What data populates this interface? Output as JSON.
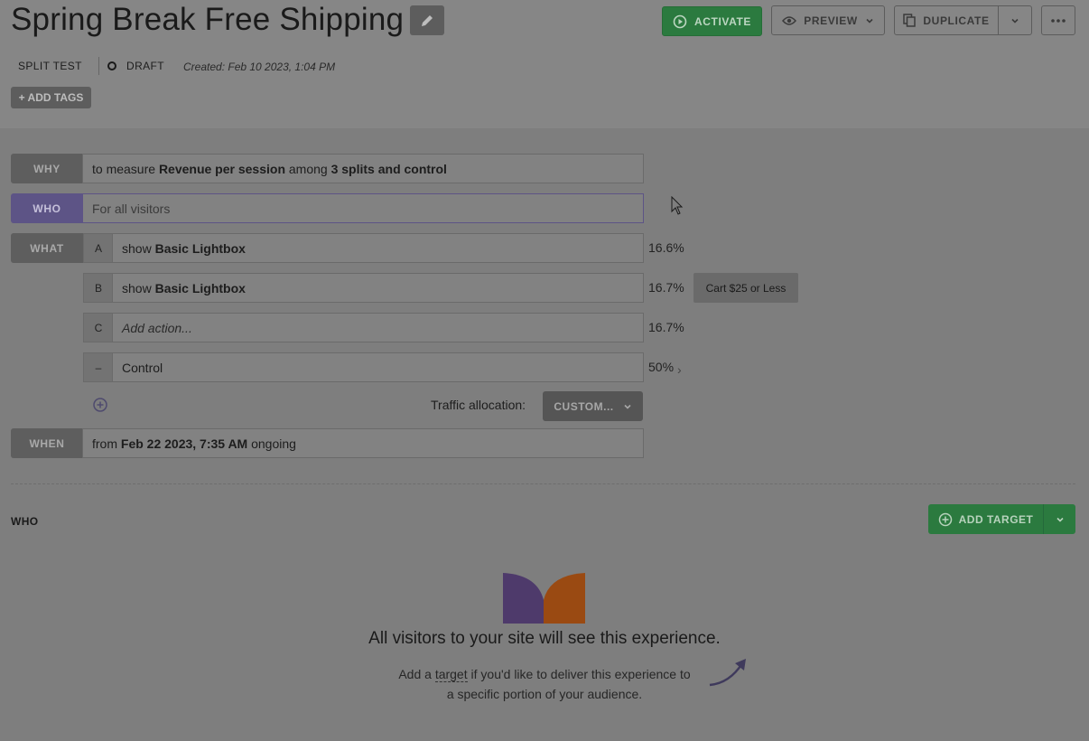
{
  "header": {
    "title": "Spring Break Free Shipping",
    "activate_label": "ACTIVATE",
    "preview_label": "PREVIEW",
    "duplicate_label": "DUPLICATE",
    "type_label": "SPLIT TEST",
    "status_label": "DRAFT",
    "created_label": "Created: Feb 10 2023, 1:04 PM",
    "add_tags_label": "+ ADD TAGS"
  },
  "why": {
    "label": "WHY",
    "prefix": "to measure ",
    "metric": "Revenue per session",
    "middle": " among ",
    "groups": "3 splits and control"
  },
  "who": {
    "label": "WHO",
    "text": "For all visitors"
  },
  "what": {
    "label": "WHAT",
    "variants": [
      {
        "letter": "A",
        "prefix": "show ",
        "action": "Basic Lightbox",
        "percent": "16.6%"
      },
      {
        "letter": "B",
        "prefix": "show ",
        "action": "Basic Lightbox",
        "percent": "16.7%",
        "badge": "Cart $25 or Less"
      },
      {
        "letter": "C",
        "placeholder": "Add action...",
        "percent": "16.7%"
      },
      {
        "letter": "–",
        "text": "Control",
        "percent": "50%"
      }
    ],
    "traffic_label": "Traffic allocation:",
    "traffic_value": "CUSTOM..."
  },
  "when": {
    "label": "WHEN",
    "prefix": "from ",
    "date": "Feb 22 2023, 7:35 AM",
    "suffix": " ongoing"
  },
  "who_section": {
    "heading": "WHO",
    "add_target_label": "ADD TARGET",
    "empty_title": "All visitors to your site will see this experience.",
    "empty_line1_prefix": "Add a ",
    "empty_link": "target",
    "empty_line1_suffix": " if you'd like to deliver this experience to",
    "empty_line2": "a specific portion of your audience."
  },
  "colors": {
    "accent_green": "#2b7a3f",
    "accent_purple": "#5d5486",
    "logo_purple": "#4e3a6b",
    "logo_orange": "#9a4a12"
  }
}
